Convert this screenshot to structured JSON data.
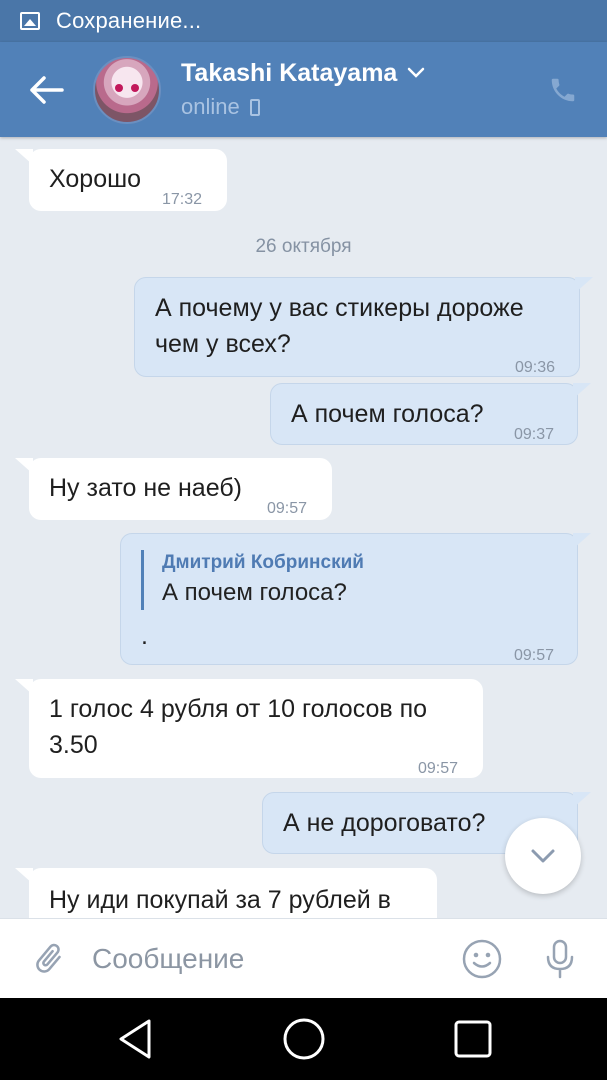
{
  "statusbar": {
    "text": "Сохранение..."
  },
  "header": {
    "name": "Takashi Katayama",
    "status": "online"
  },
  "messages": [
    {
      "direction": "in",
      "text": "Хорошо",
      "time": "17:32"
    },
    {
      "type": "date",
      "text": "26 октября"
    },
    {
      "direction": "out",
      "lines": [
        "А почему у вас стикеры дороже",
        "чем у всех?"
      ],
      "time": "09:36"
    },
    {
      "direction": "out",
      "text": "А почем голоса?",
      "time": "09:37"
    },
    {
      "direction": "in",
      "text": "Ну зато не наеб)",
      "time": "09:57"
    },
    {
      "direction": "out",
      "reply": {
        "author": "Дмитрий Кобринский",
        "text": "А почем голоса?"
      },
      "text": ".",
      "time": "09:57"
    },
    {
      "direction": "in",
      "lines": [
        "1 голос 4 рубля от 10 голосов по",
        "3.50"
      ],
      "time": "09:57"
    },
    {
      "direction": "out",
      "text": "А не дороговато?"
    },
    {
      "direction": "in",
      "text": "Ну иди покупай за 7 рублей в"
    }
  ],
  "composer": {
    "placeholder": "Сообщение"
  },
  "icons": {
    "statusbar": "image-icon",
    "back": "arrow-left-icon",
    "name_dropdown": "chevron-down-icon",
    "status_device": "phone-device-icon",
    "call": "phone-icon",
    "scroll": "chevron-down-icon",
    "attach": "paperclip-icon",
    "emoji": "smiley-icon",
    "mic": "microphone-icon",
    "nav_back": "triangle-back-icon",
    "nav_home": "circle-home-icon",
    "nav_recent": "square-recent-icon"
  },
  "colors": {
    "statusbar": "#4a76a8",
    "header": "#5181b8",
    "background": "#e6ebf1",
    "incoming_bubble": "#ffffff",
    "outgoing_bubble": "#d8e6f6",
    "accent": "#4f7bb3"
  }
}
